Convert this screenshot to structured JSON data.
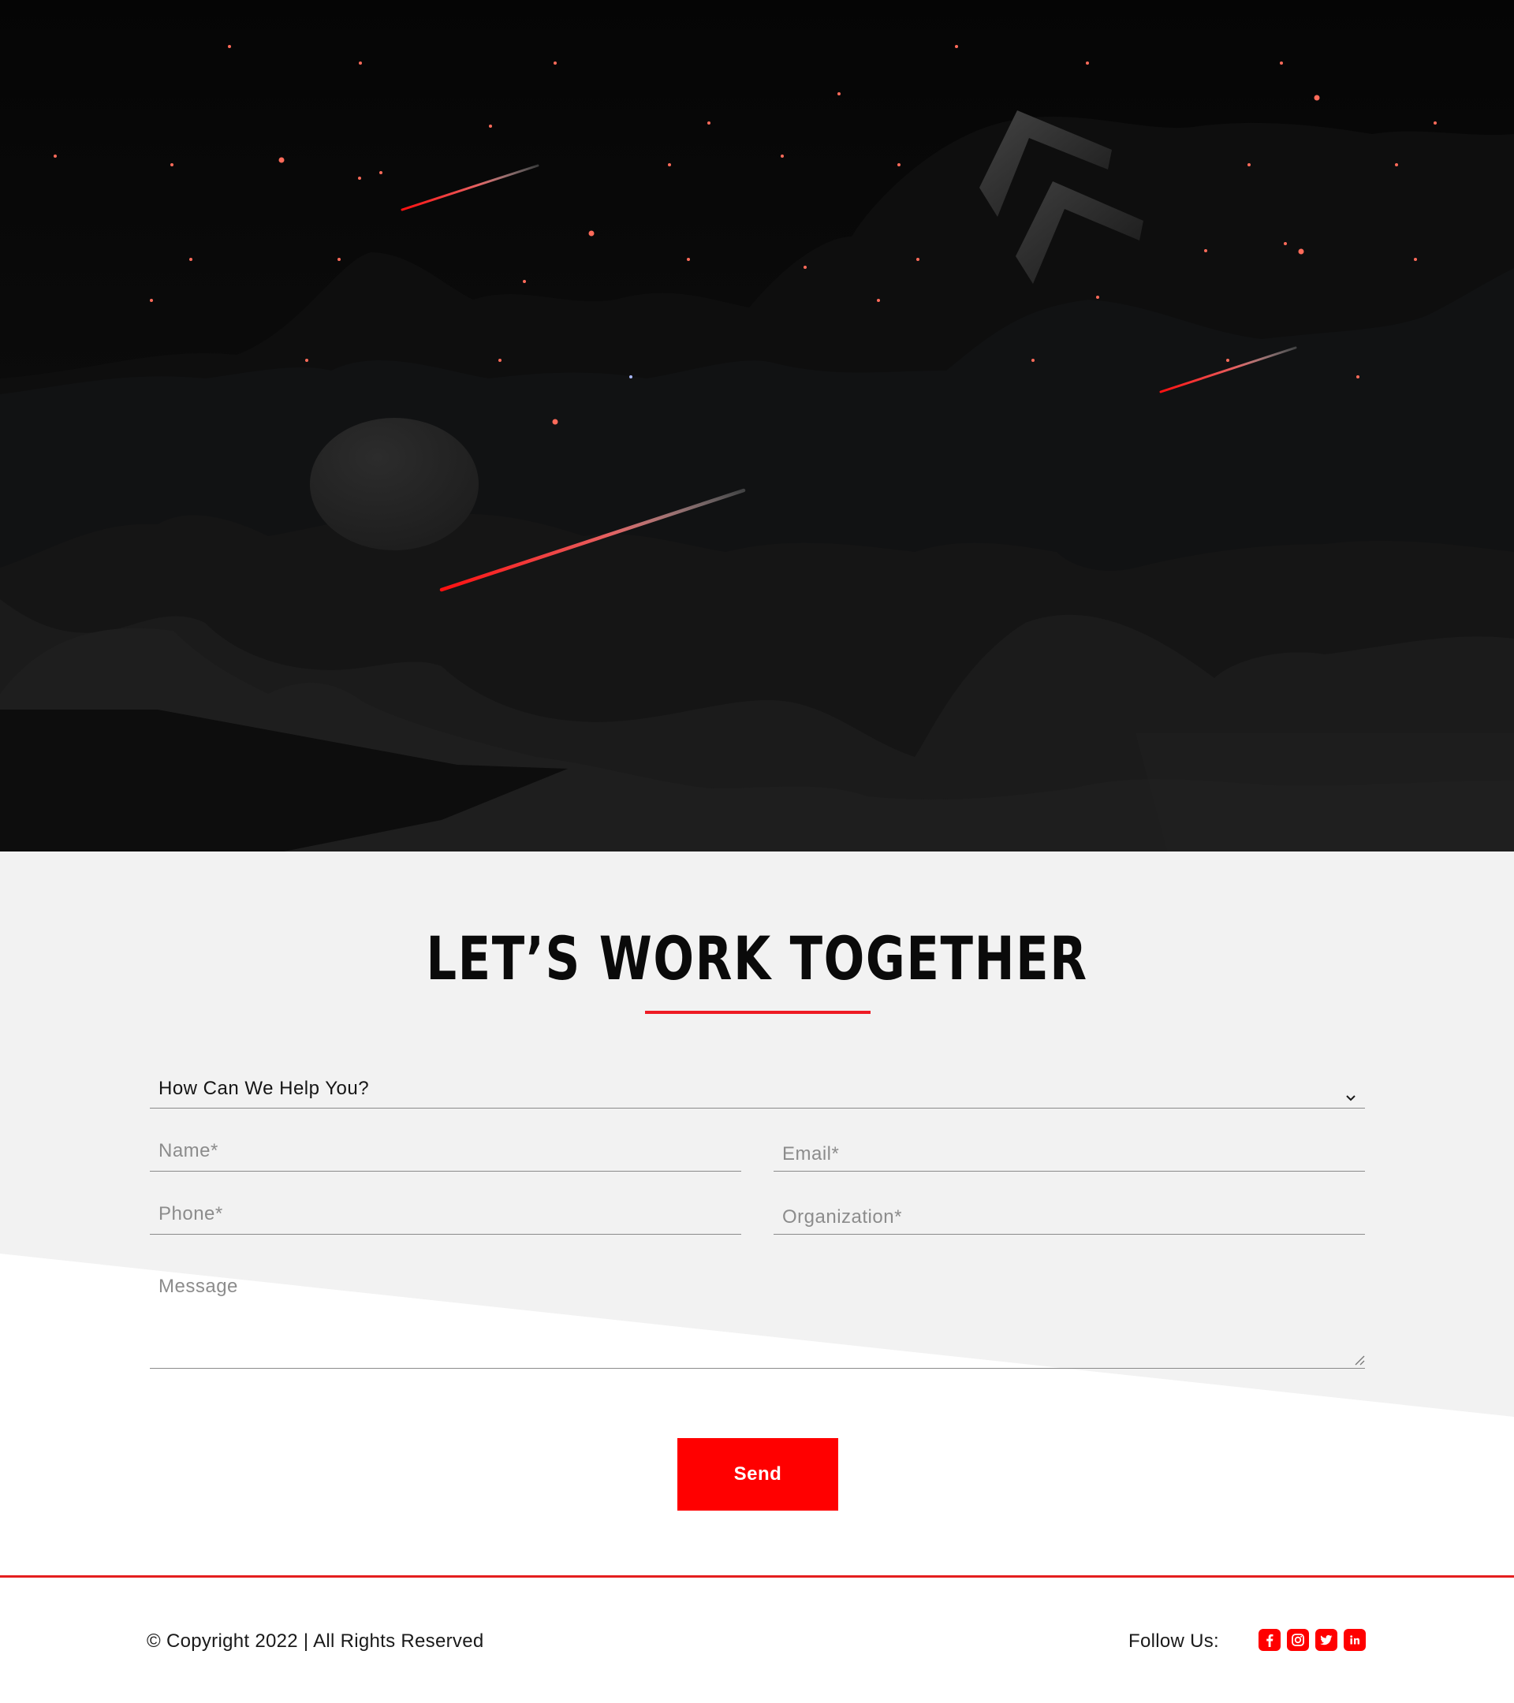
{
  "hero": {
    "moon_color": "#262626",
    "accent": "#ff1a1a"
  },
  "contact": {
    "title": "LET’S WORK TOGETHER",
    "help_select": {
      "value": "How Can We Help You?",
      "icon": "chevron-down-icon"
    },
    "fields": {
      "name_placeholder": "Name*",
      "email_placeholder": "Email*",
      "phone_placeholder": "Phone*",
      "organization_placeholder": "Organization*",
      "message_placeholder": "Message"
    },
    "send_label": "Send"
  },
  "footer": {
    "copyright": "© Copyright 2022 | All Rights Reserved",
    "follow_label": "Follow Us:",
    "social_icons": [
      "facebook-icon",
      "instagram-icon",
      "twitter-icon",
      "linkedin-icon"
    ]
  },
  "colors": {
    "brand_red": "#ff0000",
    "underline_red": "#ee1b24",
    "section_gray": "#f2f2f2",
    "hero_dark": "#0b0b0b"
  }
}
